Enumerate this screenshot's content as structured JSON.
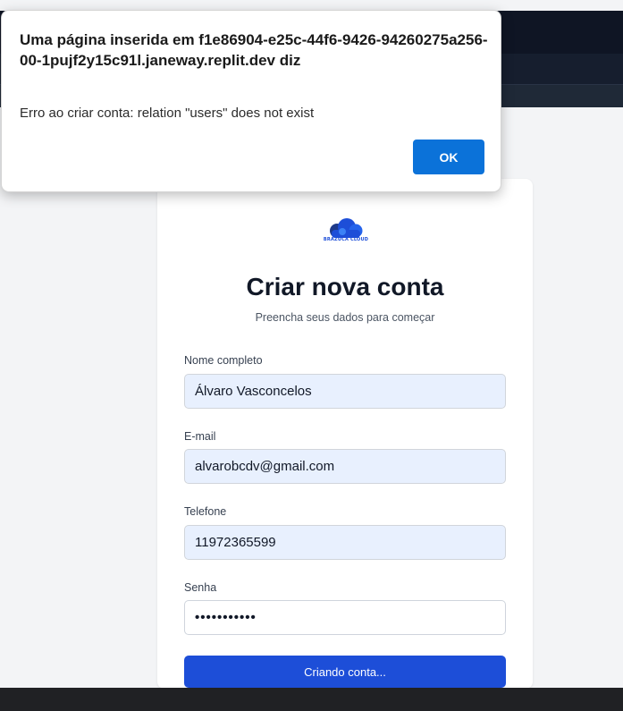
{
  "browser": {
    "dark_color": "#111827"
  },
  "card": {
    "logo_text": "BRAZUCA CLOUD",
    "title": "Criar nova conta",
    "subtitle": "Preencha seus dados para começar"
  },
  "form": {
    "name_label": "Nome completo",
    "name_value": "Álvaro Vasconcelos",
    "email_label": "E-mail",
    "email_value": "alvarobcdv@gmail.com",
    "phone_label": "Telefone",
    "phone_value": "11972365599",
    "password_label": "Senha",
    "password_mask": "•••••••••••",
    "submit_label": "Criando conta..."
  },
  "dialog": {
    "title": "Uma página inserida em f1e86904-e25c-44f6-9426-94260275a256-00-1pujf2y15c91l.janeway.replit.dev diz",
    "message": "Erro ao criar conta: relation \"users\" does not exist",
    "ok_label": "OK"
  },
  "colors": {
    "accent": "#1d4ed8",
    "dialog_button": "#0b72d9",
    "autofill_bg": "#e8f0fe"
  },
  "icons": {
    "logo": "cloud-icon"
  }
}
